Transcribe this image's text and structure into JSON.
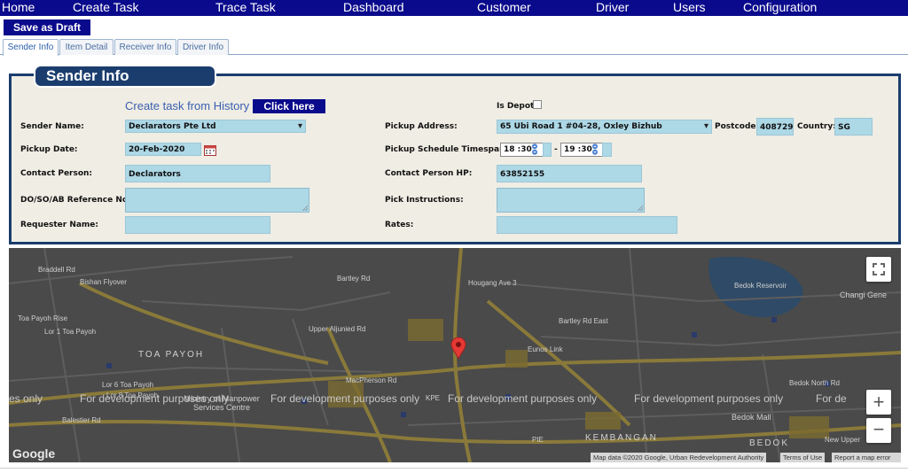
{
  "nav": {
    "items": [
      "Home",
      "Create Task",
      "Trace Task",
      "Dashboard",
      "Customer",
      "Driver",
      "Users",
      "Configuration"
    ]
  },
  "toolbar": {
    "save_draft_label": "Save as Draft"
  },
  "tabs": [
    {
      "label": "Sender Info",
      "active": true
    },
    {
      "label": "Item Detail",
      "active": false
    },
    {
      "label": "Receiver Info",
      "active": false
    },
    {
      "label": "Driver Info",
      "active": false
    }
  ],
  "panel": {
    "title": "Sender Info",
    "history_text": "Create task from History",
    "click_here_label": "Click here",
    "is_depot_label": "Is Depot",
    "is_depot_checked": false,
    "sender_name_label": "Sender Name:",
    "sender_name_value": "Declarators Pte Ltd",
    "pickup_date_label": "Pickup Date:",
    "pickup_date_value": "20-Feb-2020",
    "contact_person_label": "Contact Person:",
    "contact_person_value": "Declarators",
    "reference_label": "DO/SO/AB Reference No:",
    "reference_value": "",
    "requester_label": "Requester Name:",
    "requester_value": "",
    "pickup_address_label": "Pickup Address:",
    "pickup_address_value": "65 Ubi Road 1 #04-28, Oxley Bizhub",
    "postcode_label": "Postcode:",
    "postcode_value": "408729",
    "country_label": "Country:",
    "country_value": "SG",
    "timespan_label": "Pickup Schedule Timespan:",
    "time_from": "18 :30",
    "time_separator": "-",
    "time_to": "19 :30",
    "contact_hp_label": "Contact Person HP:",
    "contact_hp_value": "63852155",
    "instructions_label": "Pick Instructions:",
    "instructions_value": "",
    "rates_label": "Rates:",
    "rates_value": ""
  },
  "map": {
    "watermark": "For development purposes only",
    "watermark_partial_left": "es only",
    "watermark_partial_right": "For de",
    "areas": [
      "TOA PAYOH",
      "KEMBANGAN",
      "BEDOK"
    ],
    "places": [
      "Ministry of Manpower Services Centre",
      "Bedok Mall",
      "Bedok Reservoir",
      "Changi Gene"
    ],
    "roads": [
      "Braddell Rd",
      "Bishan Flyover",
      "Lor 1 Toa Payoh",
      "Toa Payoh Rise",
      "Lor 6 Toa Payoh",
      "Lor 8 Toa Payoh",
      "Balestier Rd",
      "Upper Aljunied Rd",
      "MacPherson Rd",
      "Bartley Rd",
      "Hougang Ave 3",
      "Eunos Link",
      "KPE",
      "PIE",
      "Bedok North Rd",
      "New Upper",
      "Bartley Rd East"
    ],
    "zoom_in": "+",
    "zoom_out": "−",
    "google_logo": "Google",
    "attribution": "Map data ©2020 Google, Urban Redevelopment Authority",
    "terms": "Terms of Use",
    "report": "Report a map error"
  },
  "colors": {
    "nav_bg": "#0a0a8c",
    "panel_border": "#1b3d6e",
    "panel_bg": "#efede4",
    "field_bg": "#add8e6",
    "map_bg": "#4a4a4a",
    "marker": "#e53935"
  }
}
